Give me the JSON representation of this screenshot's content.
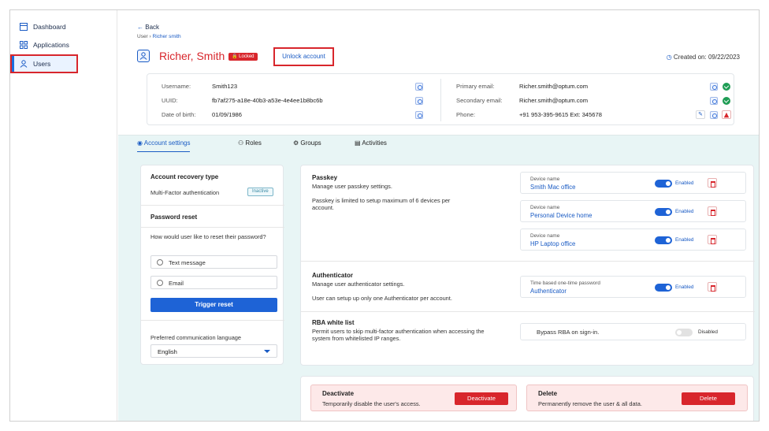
{
  "sidebar": {
    "items": [
      {
        "label": "Dashboard",
        "icon": "dashboard-icon"
      },
      {
        "label": "Applications",
        "icon": "applications-icon"
      },
      {
        "label": "Users",
        "icon": "user-icon"
      }
    ]
  },
  "header": {
    "back": "Back",
    "breadcrumb_root": "User",
    "breadcrumb_current": "Richer smith",
    "user_name": "Richer, Smith",
    "locked_badge": "Locked",
    "unlock": "Unlock account",
    "created_on": "Created on: 09/22/2023"
  },
  "info": {
    "username_label": "Username:",
    "username": "Smith123",
    "uuid_label": "UUID:",
    "uuid": "fb7af275-a18e-40b3-a53e-4e4ee1b8bc6b",
    "dob_label": "Date of birth:",
    "dob": "01/09/1986",
    "primary_email_label": "Primary email:",
    "primary_email": "Richer.smith@optum.com",
    "secondary_email_label": "Secondary email:",
    "secondary_email": "Richer.smith@optum.com",
    "phone_label": "Phone:",
    "phone": "+91 953-395-9615  Ext: 345678"
  },
  "tabs": [
    "Account settings",
    "Roles",
    "Groups",
    "Activities"
  ],
  "left": {
    "recovery_title": "Account recovery type",
    "mfa": "Multi-Factor authentication",
    "inactive": "Inactive",
    "reset_title": "Password reset",
    "reset_question": "How would user like to reset their password?",
    "opt_text": "Text message",
    "opt_email": "Email",
    "trigger": "Trigger reset",
    "lang_label": "Preferred communication language",
    "lang_value": "English"
  },
  "passkey": {
    "title": "Passkey",
    "desc": "Manage user passkey settings.",
    "note": "Passkey is limited to setup maximum of 6 devices per account.",
    "device_label": "Device name",
    "devices": [
      "Smith Mac office",
      "Personal Device home",
      "HP Laptop office"
    ],
    "status": "Enabled"
  },
  "authenticator": {
    "title": "Authenticator",
    "desc": "Manage user authenticator settings.",
    "note": "User can setup up only one Authenticator per account.",
    "totp_label": "Time based one-time password",
    "totp_value": "Authenticator",
    "status": "Enabled"
  },
  "rba": {
    "title": "RBA white list",
    "desc": "Permit users to skip multi-factor authentication when accessing the system from whitelisted IP ranges.",
    "bypass": "Bypass RBA on sign-in.",
    "status": "Disabled"
  },
  "danger": {
    "deactivate_title": "Deactivate",
    "deactivate_desc": "Temporarily disable the user's access.",
    "deactivate_btn": "Deactivate",
    "delete_title": "Delete",
    "delete_desc": "Permanently remove the user & all data.",
    "delete_btn": "Delete"
  },
  "colors": {
    "accent": "#1e63d6",
    "danger": "#d8262c",
    "bg": "#e8f5f5"
  }
}
